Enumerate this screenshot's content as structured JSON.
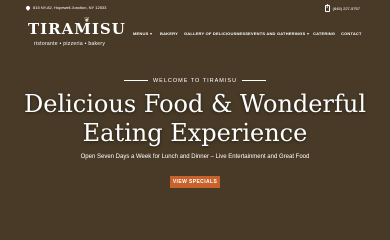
{
  "topbar": {
    "address": "815 NY-82, Hopewell Junction, NY 12533",
    "facebook": "f",
    "phone": "(845) 227-5757"
  },
  "logo": {
    "name": "TIRAMISU",
    "tagline": "ristorante • pizzeria • bakery"
  },
  "nav": [
    {
      "label": "MENUS",
      "dropdown": true
    },
    {
      "label": "BAKERY",
      "dropdown": false
    },
    {
      "label": "GALLERY OF DELICIOUSNESS",
      "dropdown": false
    },
    {
      "label": "EVENTS AND GATHERINGS",
      "dropdown": true
    },
    {
      "label": "CATERING",
      "dropdown": false
    },
    {
      "label": "CONTACT",
      "dropdown": false
    }
  ],
  "hero": {
    "eyebrow": "WELCOME TO TIRAMISU",
    "headline_line1": "Delicious Food & Wonderful",
    "headline_line2": "Eating Experience",
    "subtext": "Open Seven Days a Week for Lunch and Dinner – Live Entertainment and Great Food",
    "cta_label": "VIEW SPECIALS"
  },
  "colors": {
    "cta": "#c9622a",
    "text": "#ffffff"
  }
}
